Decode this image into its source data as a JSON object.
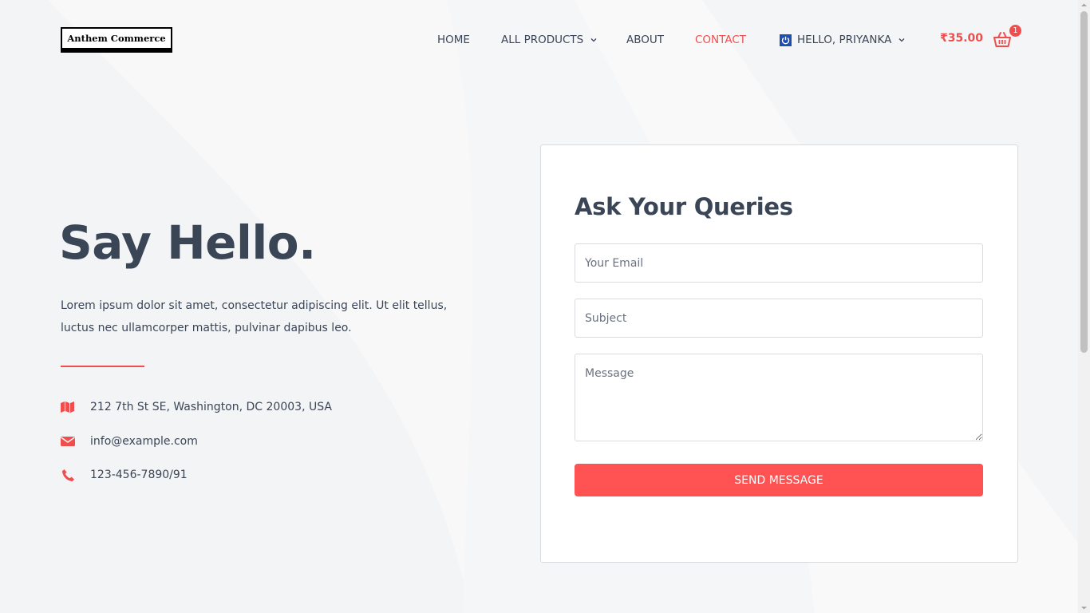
{
  "brand": {
    "logo_text": "Anthem Commerce"
  },
  "nav": {
    "home": "HOME",
    "all_products": "ALL PRODUCTS",
    "about": "ABOUT",
    "contact": "CONTACT",
    "user_greeting": "HELLO, PRIYANKA"
  },
  "cart": {
    "total": "₹35.00",
    "count": "1"
  },
  "hero": {
    "title": "Say Hello.",
    "text": "Lorem ipsum dolor sit amet, consectetur adipiscing elit. Ut elit tellus, luctus nec ullamcorper mattis, pulvinar dapibus leo."
  },
  "contact_info": {
    "address": "212 7th St SE, Washington, DC 20003, USA",
    "email": "info@example.com",
    "phone": "123-456-7890/91"
  },
  "form": {
    "title": "Ask Your Queries",
    "email_placeholder": "Your Email",
    "subject_placeholder": "Subject",
    "message_placeholder": "Message",
    "submit_label": "SEND MESSAGE"
  },
  "colors": {
    "accent": "#ff5252",
    "text": "#3a4556",
    "background": "#f3f4f5"
  }
}
